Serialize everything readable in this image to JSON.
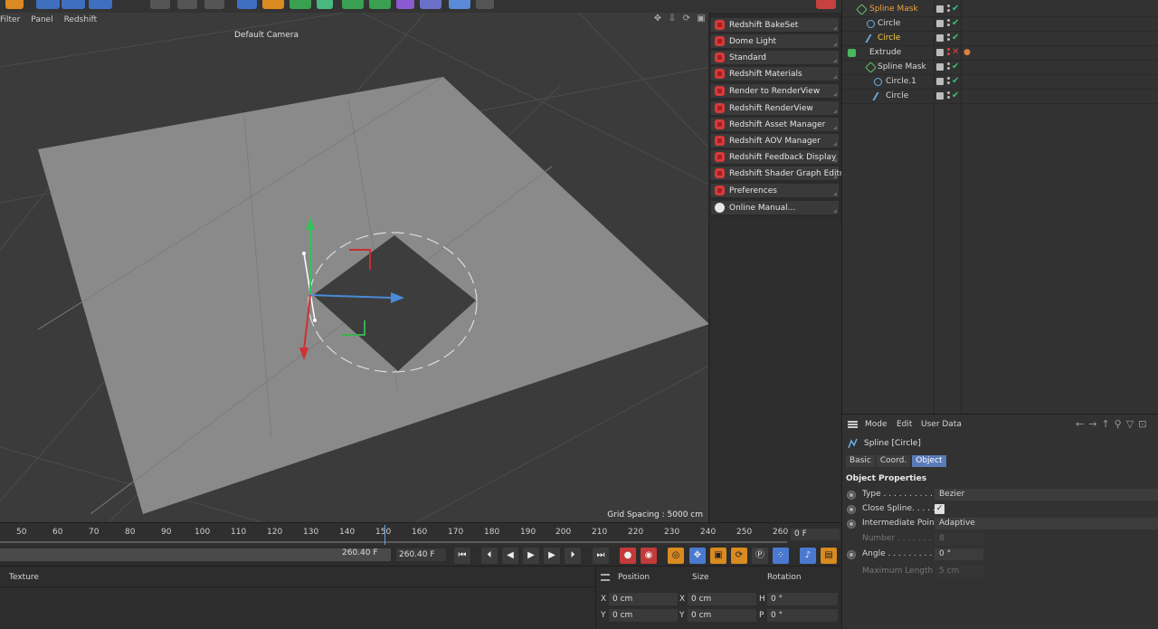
{
  "viewport": {
    "menu": [
      "Filter",
      "Panel",
      "Redshift"
    ],
    "camera": "Default Camera",
    "grid_spacing": "Grid Spacing : 5000 cm"
  },
  "redshift_menu": {
    "items": [
      {
        "label": "Redshift BakeSet",
        "icon": "redshift-cube-icon"
      },
      {
        "label": "Dome Light",
        "icon": "redshift-cube-icon"
      },
      {
        "label": "Standard",
        "icon": "redshift-cube-icon"
      },
      {
        "label": "Redshift Materials",
        "icon": "redshift-cube-icon"
      },
      {
        "label": "Render to RenderView",
        "icon": "redshift-cube-icon"
      },
      {
        "label": "Redshift RenderView",
        "icon": "redshift-cube-icon"
      },
      {
        "label": "Redshift Asset Manager",
        "icon": "redshift-cube-icon"
      },
      {
        "label": "Redshift AOV Manager",
        "icon": "redshift-cube-icon"
      },
      {
        "label": "Redshift Feedback Display",
        "icon": "redshift-cube-icon"
      },
      {
        "label": "Redshift Shader Graph Editor",
        "icon": "redshift-cube-icon"
      },
      {
        "label": "Preferences",
        "icon": "redshift-cube-icon"
      },
      {
        "label": "Online Manual...",
        "icon": "help-circle-icon"
      }
    ]
  },
  "object_manager": {
    "rows": [
      {
        "name": "Spline Mask",
        "icon": "spline-mask-icon",
        "color": "#f0a040",
        "status": "check"
      },
      {
        "name": "Circle",
        "icon": "circle-icon",
        "color": "#d8d8d8",
        "status": "check"
      },
      {
        "name": "Circle",
        "icon": "spline-icon",
        "color": "#f5d040",
        "status": "check"
      },
      {
        "name": "Extrude",
        "icon": "extrude-icon",
        "color": "#d8d8d8",
        "status": "cross"
      },
      {
        "name": "Spline Mask",
        "icon": "spline-mask-icon",
        "color": "#d8d8d8",
        "status": "check"
      },
      {
        "name": "Circle.1",
        "icon": "circle-icon",
        "color": "#d8d8d8",
        "status": "check"
      },
      {
        "name": "Circle",
        "icon": "spline-icon",
        "color": "#d8d8d8",
        "status": "check"
      }
    ]
  },
  "attributes": {
    "menu": [
      "Mode",
      "Edit",
      "User Data"
    ],
    "title": "Spline [Circle]",
    "tabs": [
      "Basic",
      "Coord.",
      "Object"
    ],
    "active_tab": "Object",
    "section": "Object Properties",
    "type_label": "Type . . . . . . . . . . .",
    "type_value": "Bezier",
    "close_label": "Close Spline. . . . . .",
    "close_checked": "✓",
    "intermediate_label": "Intermediate Points",
    "intermediate_value": "Adaptive",
    "number_label": "Number . . . . . . . .",
    "number_value": "8",
    "angle_label": "Angle . . . . . . . . .",
    "angle_value": "0 °",
    "maxlen_label": "Maximum Length",
    "maxlen_value": "5 cm"
  },
  "timeline": {
    "ticks": [
      "50",
      "60",
      "70",
      "80",
      "90",
      "100",
      "110",
      "120",
      "130",
      "140",
      "150",
      "160",
      "170",
      "180",
      "190",
      "200",
      "210",
      "220",
      "230",
      "240",
      "250",
      "260"
    ],
    "current_frame": "0 F"
  },
  "transport": {
    "range_end": "260.40 F",
    "end_field": "260.40 F"
  },
  "material": {
    "label": "Texture"
  },
  "coordinates": {
    "headers": [
      "Position",
      "Size",
      "Rotation"
    ],
    "rows": [
      {
        "axis": "X",
        "pos": "0 cm",
        "size_axis": "X",
        "size": "0 cm",
        "rot_axis": "H",
        "rot": "0 °"
      },
      {
        "axis": "Y",
        "pos": "0 cm",
        "size_axis": "Y",
        "size": "0 cm",
        "rot_axis": "P",
        "rot": "0 °"
      }
    ]
  },
  "colors": {
    "accent": "#5a7ab8",
    "redshift": "#d63a3a",
    "check": "#38c070",
    "plane": "#8a8a8a"
  }
}
